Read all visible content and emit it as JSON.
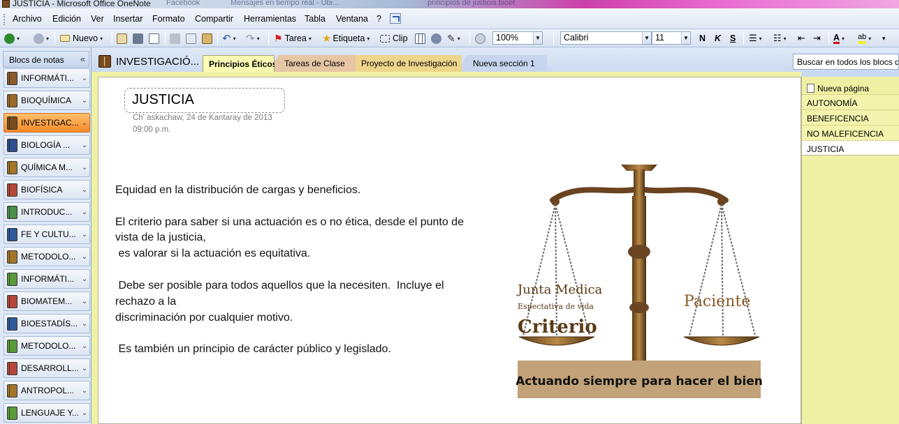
{
  "window": {
    "title": "JUSTICIA - Microsoft Office OneNote",
    "ghost_tabs": [
      "Facebook",
      "Mensajes en tiempo real - Ubi...",
      "principios de justicia bioet"
    ]
  },
  "menu": {
    "items": [
      "Archivo",
      "Edición",
      "Ver",
      "Insertar",
      "Formato",
      "Compartir",
      "Herramientas",
      "Tabla",
      "Ventana",
      "?"
    ]
  },
  "toolbar": {
    "new_label": "Nuevo",
    "task_label": "Tarea",
    "tag_label": "Etiqueta",
    "clip_label": "Clip",
    "zoom": "100%",
    "font": "Calibri",
    "size": "11",
    "bold": "N",
    "italic": "K",
    "underline": "S",
    "font_color": "A",
    "highlight": "ab"
  },
  "notebooks": {
    "header": "Blocs de notas",
    "items": [
      {
        "label": "INFORMÁTI...",
        "color": "#8b5a2b"
      },
      {
        "label": "BIOQUÍMICA",
        "color": "#9a6a2a"
      },
      {
        "label": "INVESTIGAC...",
        "color": "#7a4b1c"
      },
      {
        "label": "BIOLOGÍA ...",
        "color": "#2e4c8f"
      },
      {
        "label": "QUÍMICA M...",
        "color": "#a2752b"
      },
      {
        "label": "BIOFÍSICA",
        "color": "#b3473a"
      },
      {
        "label": "INTRODUC...",
        "color": "#4a8f4a"
      },
      {
        "label": "FE Y CULTU...",
        "color": "#2f5a9a"
      },
      {
        "label": "METODOLO...",
        "color": "#a2752b"
      },
      {
        "label": "INFORMÁTI...",
        "color": "#5a9a3a"
      },
      {
        "label": "BIOMATEM...",
        "color": "#b3473a"
      },
      {
        "label": "BIOESTADÍS...",
        "color": "#2f5a9a"
      },
      {
        "label": "METODOLO...",
        "color": "#5a9a3a"
      },
      {
        "label": "DESARROLL...",
        "color": "#b3473a"
      },
      {
        "label": "ANTROPOL...",
        "color": "#a2752b"
      },
      {
        "label": "LENGUAJE Y...",
        "color": "#5a9a3a"
      }
    ]
  },
  "notebook_title": "INVESTIGACIÓ...",
  "sections": [
    {
      "label": "Principios Éticos",
      "color": "#fbfbb4"
    },
    {
      "label": "Tareas de Clase",
      "color": "#e6c6a4"
    },
    {
      "label": "Proyecto de Investigación",
      "color": "#efd58c"
    },
    {
      "label": "Nueva sección 1",
      "color": "#c7d6ee"
    }
  ],
  "search": {
    "placeholder": "Buscar en todos los blocs de notas"
  },
  "page": {
    "title": "JUSTICIA",
    "date": "Ch' askachaw, 24 de Kantaray de 2013",
    "time": "09:00 p.m.",
    "lines": [
      "Equidad en la distribución de cargas y beneficios.",
      "El criterio para saber si una actuación es o  no ética, desde el punto de",
      "vista de la justicia,",
      " es valorar si la actuación es equitativa.",
      " Debe ser posible para todos aquellos que la necesiten.  Incluye el",
      "rechazo a la",
      "discriminación por cualquier motivo.",
      " Es también un principio de carácter público y legislado."
    ]
  },
  "image": {
    "left_label_1": "Junta Medica",
    "left_label_2": "Espectativa de vida",
    "left_label_3": "Criterio",
    "right_label": "Paciente",
    "caption": "\"Actuando siempre para hacer el bien\""
  },
  "pages_pane": {
    "new_page": "Nueva página",
    "items": [
      "AUTONOMÍA",
      "BENEFICENCIA",
      "NO MALEFICENCIA",
      "JUSTICIA"
    ]
  }
}
